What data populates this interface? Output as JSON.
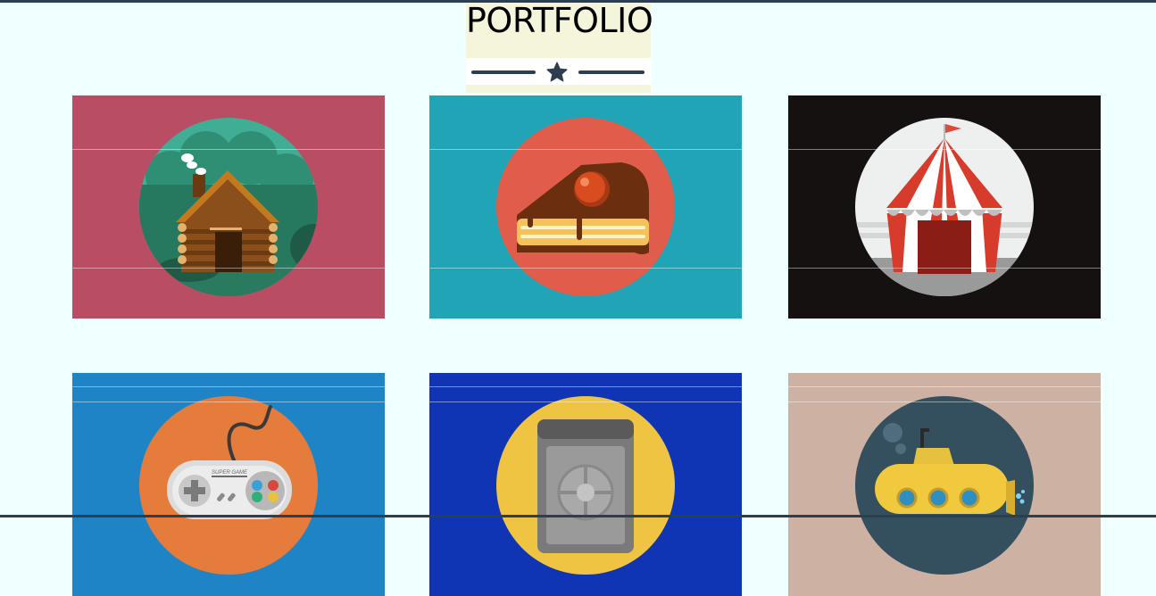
{
  "header": {
    "title": "PORTFOLIO",
    "divider_icon": "star-icon"
  },
  "portfolio": {
    "items": [
      {
        "name": "cabin",
        "icon": "log-cabin-icon",
        "bg": "#b94d64",
        "circle": "#3fae95"
      },
      {
        "name": "cake",
        "icon": "cake-slice-icon",
        "bg": "#20a4b6",
        "circle": "#e05d4b"
      },
      {
        "name": "circus",
        "icon": "circus-tent-icon",
        "bg": "#141110",
        "circle": "#eef0f0"
      },
      {
        "name": "game",
        "icon": "game-controller-icon",
        "bg": "#1f84c6",
        "circle": "#e67c3c",
        "controller_text": "SUPER GAME"
      },
      {
        "name": "safe",
        "icon": "safe-icon",
        "bg": "#1035b4",
        "circle": "#efc442"
      },
      {
        "name": "submarine",
        "icon": "submarine-icon",
        "bg": "#cdb1a3",
        "circle": "#344f5e"
      }
    ]
  },
  "colors": {
    "page_bg": "#f0ffff",
    "header_bg": "#f5f5dc",
    "divider": "#2c3e50"
  }
}
